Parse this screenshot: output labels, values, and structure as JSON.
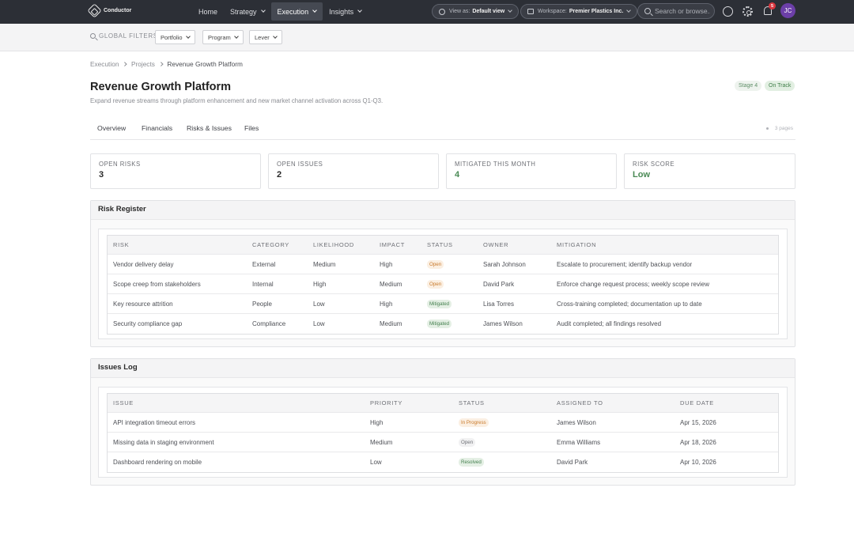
{
  "app": {
    "brand": "Conductor",
    "nav": [
      {
        "label": "Home"
      },
      {
        "label": "Strategy"
      },
      {
        "label": "Execution"
      },
      {
        "label": "Insights"
      }
    ],
    "view_as_label": "View as:",
    "view_as_value": "Default view",
    "workspace_label": "Workspace:",
    "workspace_value": "Premier Plastics Inc.",
    "search_placeholder": "Search or browse...",
    "notification_count": "5",
    "avatar_initials": "JC"
  },
  "filters": {
    "label": "GLOBAL FILTERS",
    "dropdowns": [
      "Portfolio",
      "Program",
      "Lever"
    ]
  },
  "breadcrumb": [
    "Execution",
    "Projects",
    "Revenue Growth Platform"
  ],
  "project": {
    "title": "Revenue Growth Platform",
    "subtitle": "Expand revenue streams through platform enhancement and new market channel activation across Q1-Q3.",
    "stage": "Stage 4",
    "status": "On Track"
  },
  "tabs": [
    "Overview",
    "Financials",
    "Risks & Issues",
    "Files"
  ],
  "pages_label": "3 pages",
  "stats": [
    {
      "label": "OPEN RISKS",
      "value": "3"
    },
    {
      "label": "OPEN ISSUES",
      "value": "2"
    },
    {
      "label": "MITIGATED THIS MONTH",
      "value": "4"
    },
    {
      "label": "RISK SCORE",
      "value": "Low"
    }
  ],
  "risk_register": {
    "title": "Risk Register",
    "columns": [
      "RISK",
      "CATEGORY",
      "LIKELIHOOD",
      "IMPACT",
      "STATUS",
      "OWNER",
      "MITIGATION"
    ],
    "rows": [
      {
        "risk": "Vendor delivery delay",
        "category": "External",
        "likelihood": "Medium",
        "impact": "High",
        "status": "Open",
        "owner": "Sarah Johnson",
        "mitigation": "Escalate to procurement; identify backup vendor"
      },
      {
        "risk": "Scope creep from stakeholders",
        "category": "Internal",
        "likelihood": "High",
        "impact": "Medium",
        "status": "Open",
        "owner": "David Park",
        "mitigation": "Enforce change request process; weekly scope review"
      },
      {
        "risk": "Key resource attrition",
        "category": "People",
        "likelihood": "Low",
        "impact": "High",
        "status": "Mitigated",
        "owner": "Lisa Torres",
        "mitigation": "Cross-training completed; documentation up to date"
      },
      {
        "risk": "Security compliance gap",
        "category": "Compliance",
        "likelihood": "Low",
        "impact": "Medium",
        "status": "Mitigated",
        "owner": "James Wilson",
        "mitigation": "Audit completed; all findings resolved"
      }
    ]
  },
  "issues_log": {
    "title": "Issues Log",
    "columns": [
      "ISSUE",
      "PRIORITY",
      "STATUS",
      "ASSIGNED TO",
      "DUE DATE"
    ],
    "rows": [
      {
        "issue": "API integration timeout errors",
        "priority": "High",
        "status": "In Progress",
        "assigned": "James Wilson",
        "due": "Apr 15, 2026"
      },
      {
        "issue": "Missing data in staging environment",
        "priority": "Medium",
        "status": "Open",
        "assigned": "Emma Williams",
        "due": "Apr 18, 2026"
      },
      {
        "issue": "Dashboard rendering on mobile",
        "priority": "Low",
        "status": "Resolved",
        "assigned": "David Park",
        "due": "Apr 10, 2026"
      }
    ]
  }
}
